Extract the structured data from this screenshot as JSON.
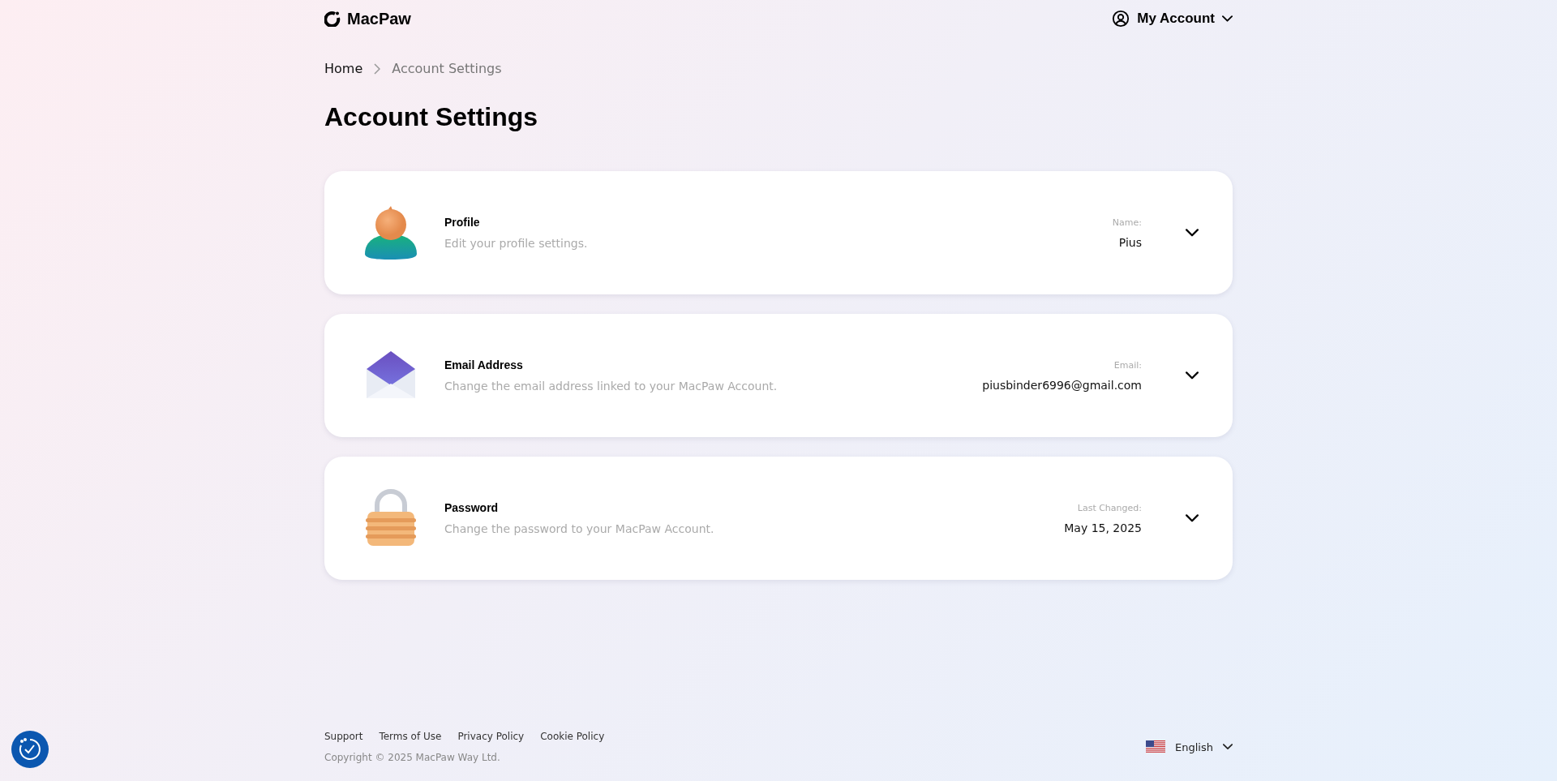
{
  "header": {
    "logo": "MacPaw",
    "account_menu": "My Account"
  },
  "breadcrumb": [
    "Home",
    "Account Settings"
  ],
  "title": "Account Settings",
  "cards": [
    {
      "kind": "profile",
      "title": "Profile",
      "description": "Edit your profile settings.",
      "field_label": "Name:",
      "field_value": "Pius",
      "expanded": false
    },
    {
      "kind": "email",
      "title": "Email Address",
      "description": "Change the email address linked to your MacPaw Account.",
      "field_label": "Email:",
      "field_value": "piusbinder6996@gmail.com",
      "expanded": false
    },
    {
      "kind": "password",
      "title": "Password",
      "description": "Change the password to your MacPaw Account.",
      "field_label": "Last Changed:",
      "field_value": "May 15, 2025",
      "expanded": false
    }
  ],
  "footer": {
    "links": [
      "Support",
      "Terms of Use",
      "Privacy Policy",
      "Cookie Policy"
    ],
    "copyright": "Copyright © 2025 MacPaw Way Ltd.",
    "language": "English"
  }
}
